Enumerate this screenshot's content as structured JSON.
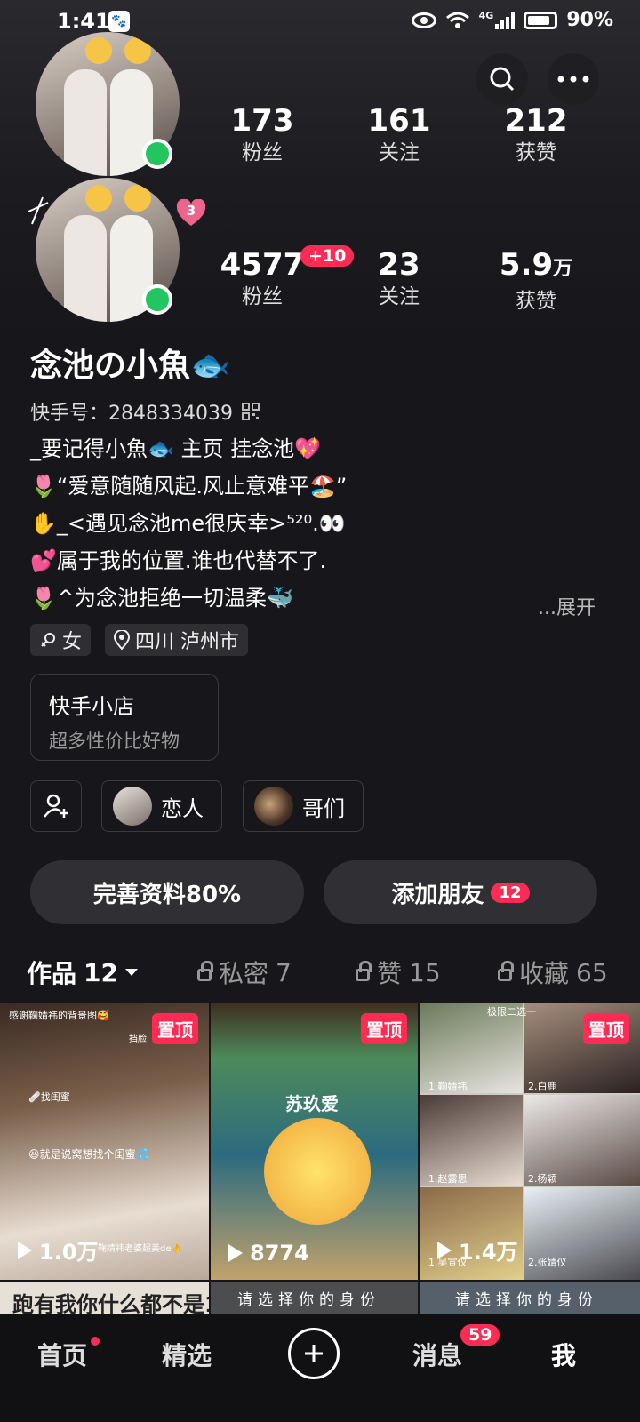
{
  "status_bar": {
    "time": "1:41",
    "network": "4G",
    "battery": "90%"
  },
  "header": {
    "icons": [
      "search-icon",
      "more-icon"
    ],
    "accounts": [
      {
        "stats": [
          {
            "value": "173",
            "label": "粉丝"
          },
          {
            "value": "161",
            "label": "关注"
          },
          {
            "value": "212",
            "label": "获赞"
          }
        ]
      },
      {
        "notif_count": "3",
        "stats": [
          {
            "value": "4577",
            "badge": "+10",
            "label": "粉丝"
          },
          {
            "value": "23",
            "label": "关注"
          },
          {
            "value": "5.9",
            "unit": "万",
            "label": "获赞"
          }
        ]
      }
    ]
  },
  "profile": {
    "name": "念池の小魚🐟",
    "kuaishou_id": "快手号：2848334039",
    "bio": [
      "_要记得小魚🐟 主页 挂念池💖",
      "🌷“爱意随随风起.风止意难平🏖️”",
      "✋_<遇见念池me很庆幸>⁵²⁰.👀",
      "💕属于我的位置.谁也代替不了.",
      "🌷^为念池拒绝一切温柔🐳"
    ],
    "expand": "...展开",
    "tags": [
      {
        "icon": "female-icon",
        "text": "女"
      },
      {
        "icon": "location-icon",
        "text": "四川 泸州市"
      }
    ]
  },
  "shop": {
    "title": "快手小店",
    "subtitle": "超多性价比好物"
  },
  "relations": [
    {
      "label": "恋人"
    },
    {
      "label": "哥们"
    }
  ],
  "actions": {
    "complete_profile": "完善资料80%",
    "add_friend": "添加朋友",
    "add_friend_badge": "12"
  },
  "tabs": [
    {
      "label": "作品",
      "count": "12",
      "active": true
    },
    {
      "label": "私密",
      "count": "7",
      "locked": true
    },
    {
      "label": "赞",
      "count": "15",
      "locked": true
    },
    {
      "label": "收藏",
      "count": "65",
      "locked": true
    }
  ],
  "grid": [
    {
      "pin": "置顶",
      "plays": "1.0万",
      "caption_top": "感谢鞠婧祎的背景图🥰",
      "caption_a": "🩹找闺蜜",
      "caption_b": "😆就是说窝想找个闺蜜💦",
      "corner": "挡脸",
      "caption_bottom": "鞠婧祎老婆超美de👌"
    },
    {
      "pin": "置顶",
      "plays": "8774",
      "caption_mid": "苏玖爱"
    },
    {
      "pin": "置顶",
      "plays": "1.4万",
      "caption_top": "极限二选一",
      "names": [
        "1.鞠婧祎",
        "2.白鹿",
        "1.赵露思",
        "2.杨颖",
        "1.吴宣仪",
        "2.张婧仪"
      ]
    },
    {
      "caption": "跑有我你什么都不是1"
    },
    {
      "caption": "请选择你的身份"
    },
    {
      "caption": "请选择你的身份"
    }
  ],
  "bottom_nav": [
    {
      "label": "首页",
      "dot": true
    },
    {
      "label": "精选"
    },
    {
      "label": "plus"
    },
    {
      "label": "消息",
      "badge": "59"
    },
    {
      "label": "我",
      "active": true
    }
  ],
  "colors": {
    "accent": "#fe2c55",
    "online": "#22c55e",
    "background": "#17171b"
  }
}
